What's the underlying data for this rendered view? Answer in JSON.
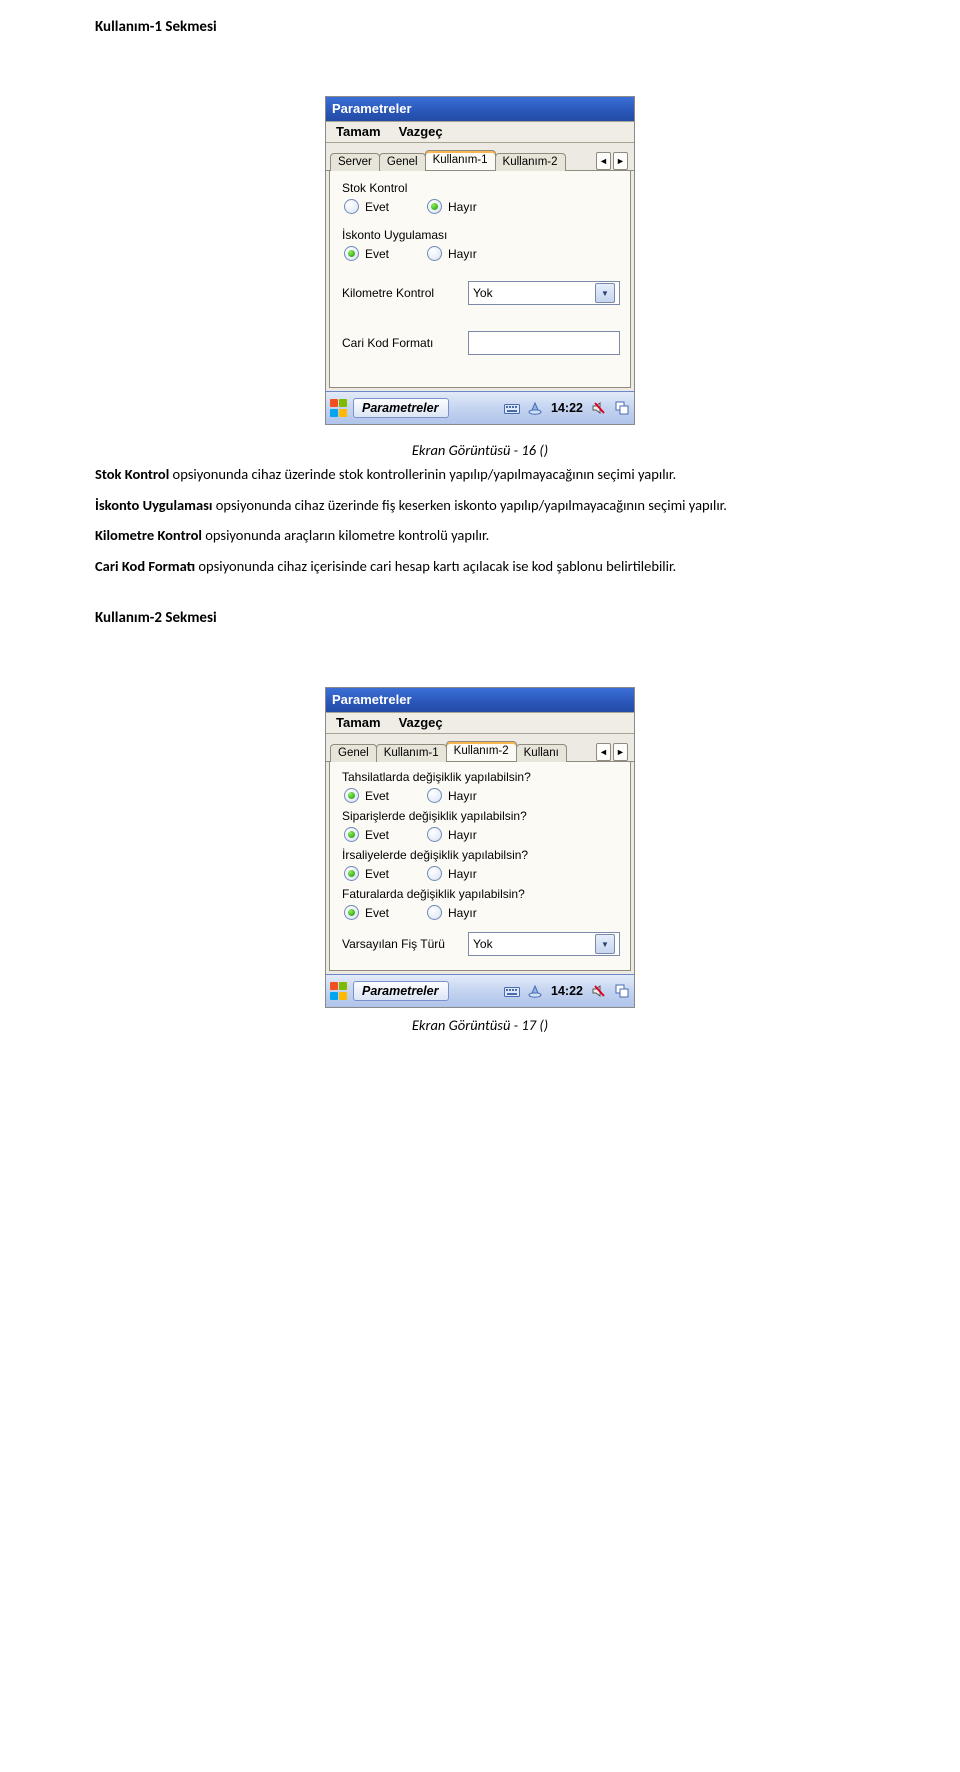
{
  "heading1": "Kullanım-1 Sekmesi",
  "heading2": "Kullanım-2 Sekmesi",
  "caption1": "Ekran Görüntüsü - 16 ()",
  "caption2": "Ekran Görüntüsü - 17 ()",
  "para1_b": "Stok Kontrol",
  "para1_t": " opsiyonunda cihaz üzerinde stok kontrollerinin yapılıp/yapılmayacağının seçimi yapılır.",
  "para2_b": "İskonto Uygulaması",
  "para2_t": " opsiyonunda cihaz üzerinde fiş keserken iskonto yapılıp/yapılmayacağının seçimi yapılır.",
  "para3_b": "Kilometre Kontrol",
  "para3_t": " opsiyonunda araçların kilometre kontrolü yapılır.",
  "para4_b": "Cari Kod Formatı",
  "para4_t": " opsiyonunda cihaz içerisinde cari hesap kartı açılacak ise kod şablonu belirtilebilir.",
  "shot1": {
    "title": "Parametreler",
    "menu_ok": "Tamam",
    "menu_cancel": "Vazgeç",
    "tabs": [
      "Server",
      "Genel",
      "Kullanım-1",
      "Kullanım-2"
    ],
    "active_tab_index": 2,
    "g1_title": "Stok Kontrol",
    "g1_evet": "Evet",
    "g1_hayir": "Hayır",
    "g1_selected": "hayir",
    "g2_title": "İskonto Uygulaması",
    "g2_evet": "Evet",
    "g2_hayir": "Hayır",
    "g2_selected": "evet",
    "row1_label": "Kilometre Kontrol",
    "row1_value": "Yok",
    "row2_label": "Cari Kod Formatı",
    "row2_value": "",
    "task_label": "Parametreler",
    "clock": "14:22"
  },
  "shot2": {
    "title": "Parametreler",
    "menu_ok": "Tamam",
    "menu_cancel": "Vazgeç",
    "tabs": [
      "Genel",
      "Kullanım-1",
      "Kullanım-2",
      "Kullanı"
    ],
    "active_tab_index": 2,
    "g1_title": "Tahsilatlarda değişiklik yapılabilsin?",
    "g2_title": "Siparişlerde değişiklik yapılabilsin?",
    "g3_title": "İrsaliyelerde değişiklik yapılabilsin?",
    "g4_title": "Faturalarda değişiklik yapılabilsin?",
    "opt_evet": "Evet",
    "opt_hayir": "Hayır",
    "row1_label": "Varsayılan Fiş Türü",
    "row1_value": "Yok",
    "task_label": "Parametreler",
    "clock": "14:22"
  }
}
